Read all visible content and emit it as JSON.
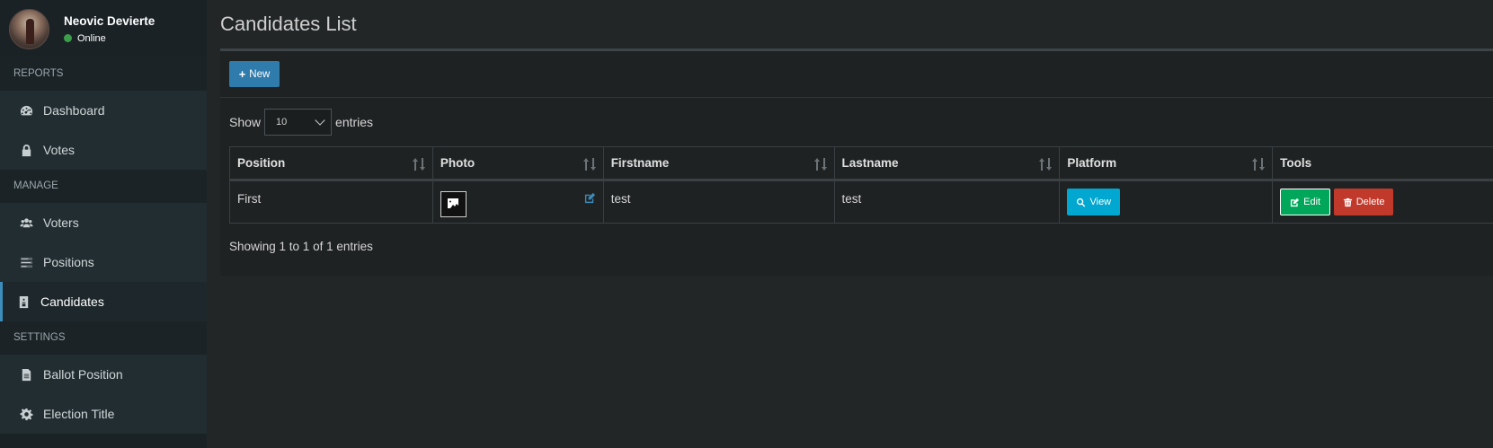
{
  "user": {
    "name": "Neovic Devierte",
    "status": "Online"
  },
  "sidebar": {
    "sections": [
      {
        "header": "REPORTS",
        "items": [
          {
            "label": "Dashboard",
            "icon": "dashboard-icon"
          },
          {
            "label": "Votes",
            "icon": "lock-icon"
          }
        ]
      },
      {
        "header": "MANAGE",
        "items": [
          {
            "label": "Voters",
            "icon": "users-icon"
          },
          {
            "label": "Positions",
            "icon": "tasks-icon"
          },
          {
            "label": "Candidates",
            "icon": "id-badge-icon",
            "active": true
          }
        ]
      },
      {
        "header": "SETTINGS",
        "items": [
          {
            "label": "Ballot Position",
            "icon": "file-icon"
          },
          {
            "label": "Election Title",
            "icon": "gear-icon"
          }
        ]
      }
    ]
  },
  "page": {
    "title": "Candidates List"
  },
  "toolbar": {
    "new_label": "New"
  },
  "length_menu": {
    "show_label": "Show",
    "value": "10",
    "entries_label": "entries"
  },
  "table": {
    "columns": [
      "Position",
      "Photo",
      "Firstname",
      "Lastname",
      "Platform",
      "Tools"
    ],
    "rows": [
      {
        "position": "First",
        "firstname": "test",
        "lastname": "test",
        "platform_button": "View",
        "edit_button": "Edit",
        "delete_button": "Delete"
      }
    ]
  },
  "info": "Showing 1 to 1 of 1 entries",
  "colors": {
    "accent": "#3c8dbc",
    "view": "#00a7d0",
    "edit": "#00a65a",
    "delete": "#c0392b",
    "sidebar_bg": "#222d32",
    "content_bg": "#222627"
  }
}
